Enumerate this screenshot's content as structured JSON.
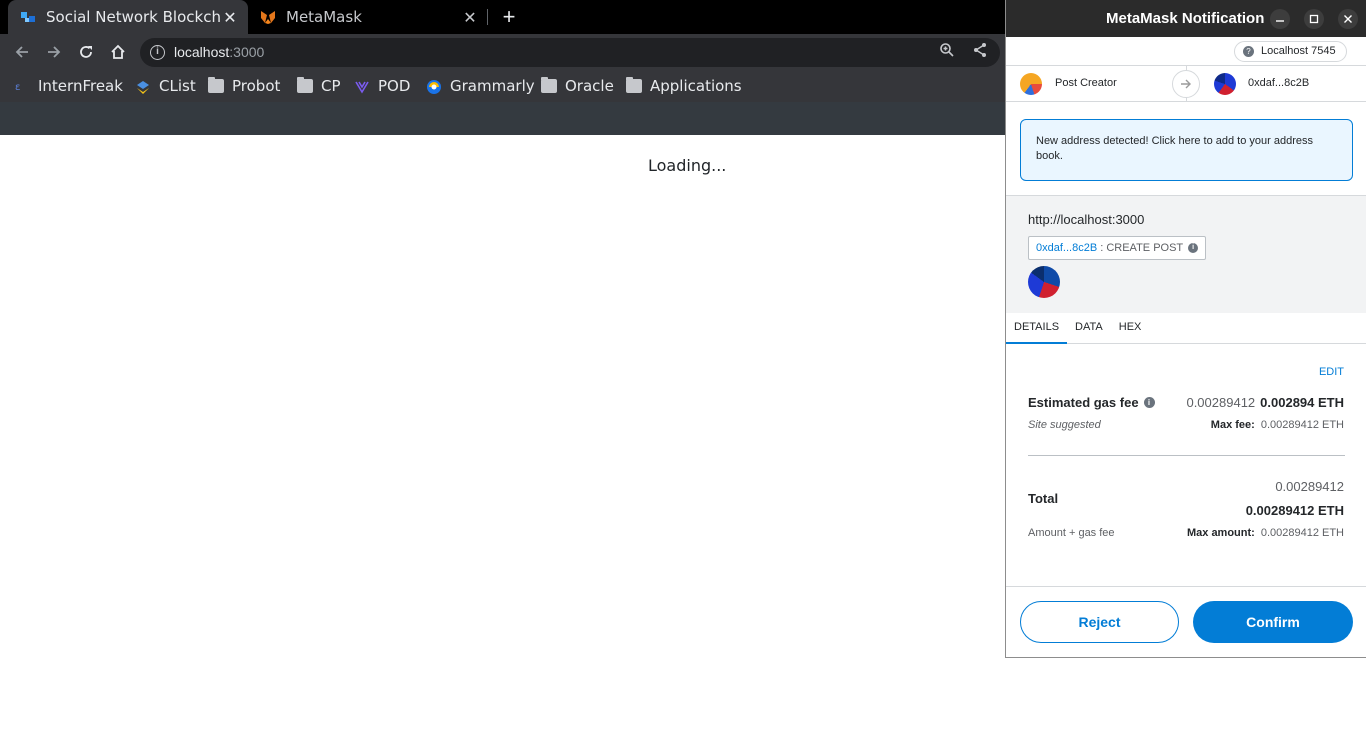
{
  "browser": {
    "tabs": [
      {
        "title": "Social Network Blockchain",
        "favicon": "blockchain-favicon",
        "active": true
      },
      {
        "title": "MetaMask",
        "favicon": "fox-favicon",
        "active": false
      }
    ],
    "close_glyph": "✕",
    "new_tab_glyph": "+",
    "url_host": "localhost",
    "url_port": ":3000",
    "bookmarks": [
      {
        "label": "InternFreak",
        "icon": "internfreak-icon"
      },
      {
        "label": "CList",
        "icon": "clist-icon"
      },
      {
        "label": "Probot",
        "icon": "folder-icon"
      },
      {
        "label": "CP",
        "icon": "folder-icon"
      },
      {
        "label": "POD",
        "icon": "pod-icon"
      },
      {
        "label": "Grammarly",
        "icon": "grammarly-icon"
      },
      {
        "label": "Oracle",
        "icon": "folder-icon"
      },
      {
        "label": "Applications",
        "icon": "folder-icon"
      }
    ]
  },
  "page": {
    "loading_text": "Loading..."
  },
  "metamask": {
    "window_title": "MetaMask Notification",
    "network": "Localhost 7545",
    "from_account": "Post Creator",
    "to_address": "0xdaf...8c2B",
    "address_notice": "New address detected! Click here to add to your address book.",
    "origin": "http://localhost:3000",
    "method_address": "0xdaf...8c2B",
    "method_name": ": CREATE POST",
    "tabs": [
      "DETAILS",
      "DATA",
      "HEX"
    ],
    "edit_label": "EDIT",
    "estimated_gas_label": "Estimated gas fee",
    "estimated_gas_value": "0.00289412",
    "estimated_gas_eth": "0.002894 ETH",
    "site_suggested": "Site suggested",
    "max_fee_label": "Max fee:",
    "max_fee_value": "0.00289412 ETH",
    "total_label": "Total",
    "total_sub": "0.00289412",
    "total_main": "0.00289412 ETH",
    "amount_gas_label": "Amount + gas fee",
    "max_amount_label": "Max amount:",
    "max_amount_value": "0.00289412 ETH",
    "reject_label": "Reject",
    "confirm_label": "Confirm"
  },
  "colors": {
    "accent": "#037dd6",
    "notice_bg": "#eaf6ff"
  }
}
